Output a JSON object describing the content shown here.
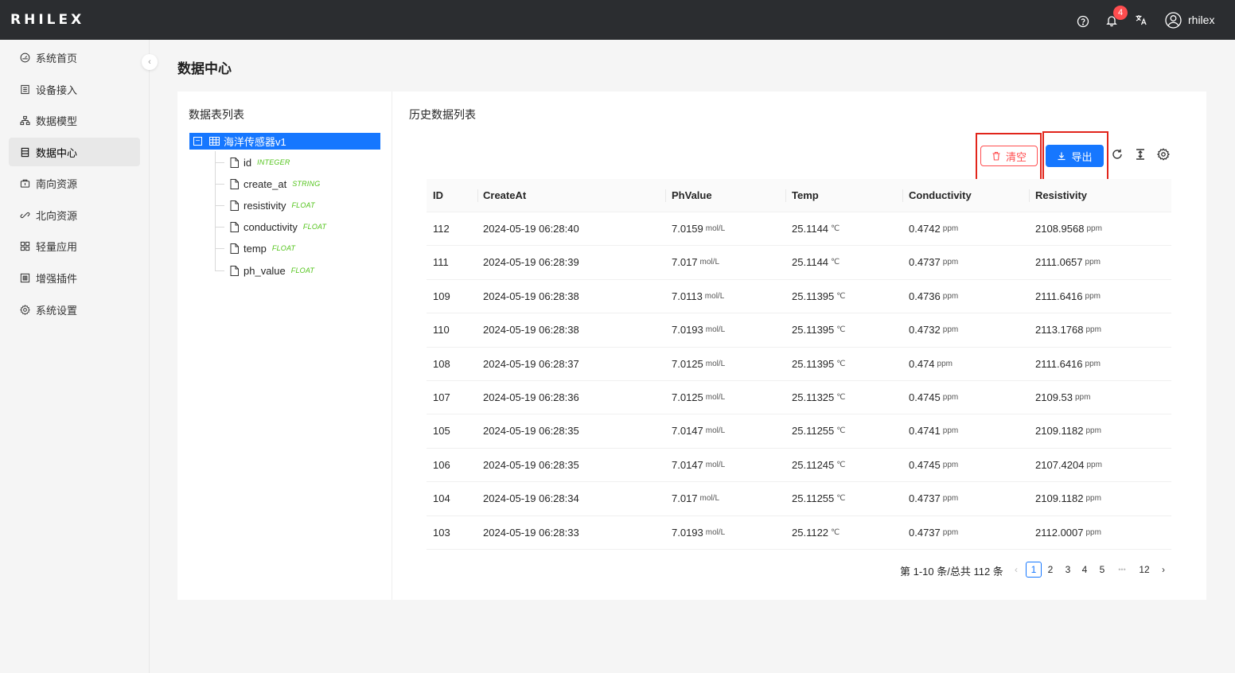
{
  "header": {
    "logo": "RHILEX",
    "notification_count": "4",
    "username": "rhilex"
  },
  "sidebar": {
    "items": [
      {
        "label": "系统首页",
        "icon": "dashboard-icon"
      },
      {
        "label": "设备接入",
        "icon": "device-icon"
      },
      {
        "label": "数据模型",
        "icon": "model-icon"
      },
      {
        "label": "数据中心",
        "icon": "data-center-icon"
      },
      {
        "label": "南向资源",
        "icon": "south-resource-icon"
      },
      {
        "label": "北向资源",
        "icon": "north-resource-icon"
      },
      {
        "label": "轻量应用",
        "icon": "app-icon"
      },
      {
        "label": "增强插件",
        "icon": "plugin-icon"
      },
      {
        "label": "系统设置",
        "icon": "settings-icon"
      }
    ],
    "active_index": 3
  },
  "page": {
    "title": "数据中心"
  },
  "tree": {
    "title": "数据表列表",
    "root_label": "海洋传感器v1",
    "fields": [
      {
        "name": "id",
        "type": "INTEGER"
      },
      {
        "name": "create_at",
        "type": "STRING"
      },
      {
        "name": "resistivity",
        "type": "FLOAT"
      },
      {
        "name": "conductivity",
        "type": "FLOAT"
      },
      {
        "name": "temp",
        "type": "FLOAT"
      },
      {
        "name": "ph_value",
        "type": "FLOAT"
      }
    ]
  },
  "history": {
    "title": "历史数据列表",
    "clear_label": "清空",
    "export_label": "导出",
    "columns": [
      "ID",
      "CreateAt",
      "PhValue",
      "Temp",
      "Conductivity",
      "Resistivity"
    ],
    "units": {
      "ph": "mol/L",
      "temp": "℃",
      "conductivity": "ppm",
      "resistivity": "ppm"
    },
    "rows": [
      {
        "id": "112",
        "create_at": "2024-05-19 06:28:40",
        "ph": "7.0159",
        "temp": "25.1144",
        "conductivity": "0.4742",
        "resistivity": "2108.9568"
      },
      {
        "id": "111",
        "create_at": "2024-05-19 06:28:39",
        "ph": "7.017",
        "temp": "25.1144",
        "conductivity": "0.4737",
        "resistivity": "2111.0657"
      },
      {
        "id": "109",
        "create_at": "2024-05-19 06:28:38",
        "ph": "7.0113",
        "temp": "25.11395",
        "conductivity": "0.4736",
        "resistivity": "2111.6416"
      },
      {
        "id": "110",
        "create_at": "2024-05-19 06:28:38",
        "ph": "7.0193",
        "temp": "25.11395",
        "conductivity": "0.4732",
        "resistivity": "2113.1768"
      },
      {
        "id": "108",
        "create_at": "2024-05-19 06:28:37",
        "ph": "7.0125",
        "temp": "25.11395",
        "conductivity": "0.474",
        "resistivity": "2111.6416"
      },
      {
        "id": "107",
        "create_at": "2024-05-19 06:28:36",
        "ph": "7.0125",
        "temp": "25.11325",
        "conductivity": "0.4745",
        "resistivity": "2109.53"
      },
      {
        "id": "105",
        "create_at": "2024-05-19 06:28:35",
        "ph": "7.0147",
        "temp": "25.11255",
        "conductivity": "0.4741",
        "resistivity": "2109.1182"
      },
      {
        "id": "106",
        "create_at": "2024-05-19 06:28:35",
        "ph": "7.0147",
        "temp": "25.11245",
        "conductivity": "0.4745",
        "resistivity": "2107.4204"
      },
      {
        "id": "104",
        "create_at": "2024-05-19 06:28:34",
        "ph": "7.017",
        "temp": "25.11255",
        "conductivity": "0.4737",
        "resistivity": "2109.1182"
      },
      {
        "id": "103",
        "create_at": "2024-05-19 06:28:33",
        "ph": "7.0193",
        "temp": "25.1122",
        "conductivity": "0.4737",
        "resistivity": "2112.0007"
      }
    ]
  },
  "pagination": {
    "total_text": "第 1-10 条/总共 112 条",
    "pages": [
      "1",
      "2",
      "3",
      "4",
      "5"
    ],
    "ellipsis": "•••",
    "last_page": "12",
    "current": "1"
  }
}
